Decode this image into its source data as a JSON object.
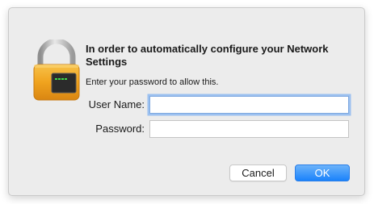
{
  "dialog": {
    "title": "In order to automatically configure your Network Settings",
    "subtitle": "Enter your password to allow this.",
    "icon": "padlock-terminal-icon"
  },
  "fields": {
    "username": {
      "label": "User Name:",
      "value": ""
    },
    "password": {
      "label": "Password:",
      "value": ""
    }
  },
  "buttons": {
    "cancel_label": "Cancel",
    "ok_label": "OK"
  },
  "colors": {
    "accent": "#1a82fb",
    "focus_ring": "#9cc1f0",
    "dialog_bg": "#ececec",
    "lock_body": "#f0a31e"
  }
}
